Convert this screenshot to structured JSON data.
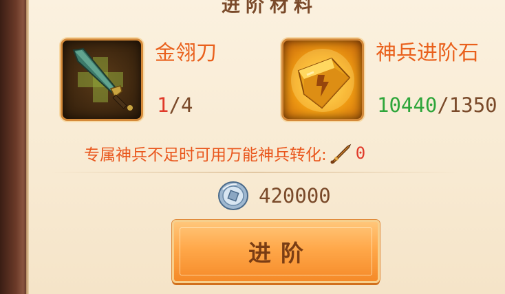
{
  "header": {
    "title": "进阶材料"
  },
  "materials": [
    {
      "name": "金翎刀",
      "owned": "1",
      "separator": "/",
      "required": "4",
      "icon": "golden-feather-blade-icon",
      "owned_color": "#e03a2a"
    },
    {
      "name": "神兵进阶石",
      "owned": "10440",
      "separator": "/",
      "required": "1350",
      "icon": "divine-weapon-upgrade-stone-icon",
      "owned_color": "#2ea63a"
    }
  ],
  "conversion": {
    "text": "专属神兵不足时可用万能神兵转化:",
    "value": "0",
    "icon": "universal-weapon-icon"
  },
  "cost": {
    "icon": "silver-coin-icon",
    "value": "420000"
  },
  "actions": {
    "upgrade_label": "进阶"
  },
  "colors": {
    "accent": "#e9601c",
    "button": "#ffa84a",
    "text": "#7a4a2a"
  }
}
